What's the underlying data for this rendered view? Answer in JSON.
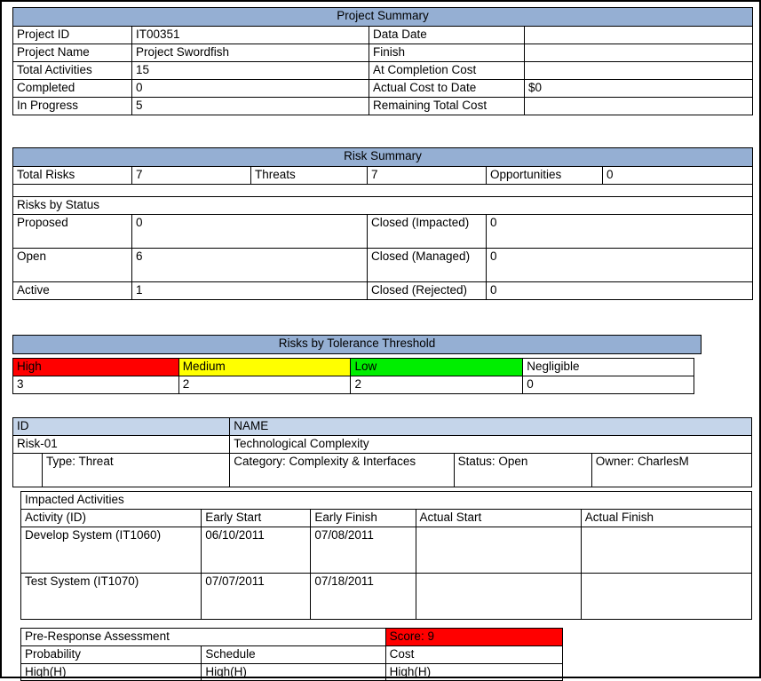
{
  "project_summary": {
    "title": "Project Summary",
    "rows": [
      {
        "label_left": "Project ID",
        "value_left": "IT00351",
        "label_right": "Data Date",
        "value_right": ""
      },
      {
        "label_left": "Project Name",
        "value_left": "Project Swordfish",
        "label_right": "Finish",
        "value_right": ""
      },
      {
        "label_left": "Total Activities",
        "value_left": "15",
        "label_right": "At Completion Cost",
        "value_right": ""
      },
      {
        "label_left": "Completed",
        "value_left": "0",
        "label_right": "Actual Cost to Date",
        "value_right": "$0"
      },
      {
        "label_left": "In Progress",
        "value_left": "5",
        "label_right": "Remaining Total Cost",
        "value_right": ""
      }
    ]
  },
  "risk_summary": {
    "title": "Risk Summary",
    "totals": {
      "total_risks_label": "Total Risks",
      "total_risks_value": "7",
      "threats_label": "Threats",
      "threats_value": "7",
      "opportunities_label": "Opportunities",
      "opportunities_value": "0"
    },
    "spacer": "",
    "status_header": "Risks by Status",
    "status_rows": [
      {
        "label_left": "Proposed",
        "value_left": "0",
        "label_right": "Closed (Impacted)",
        "value_right": "0"
      },
      {
        "label_left": "Open",
        "value_left": "6",
        "label_right": "Closed (Managed)",
        "value_right": "0"
      },
      {
        "label_left": "Active",
        "value_left": "1",
        "label_right": "Closed (Rejected)",
        "value_right": "0"
      }
    ]
  },
  "tolerance": {
    "title": "Risks by Tolerance Threshold",
    "columns": [
      {
        "label": "High",
        "value": "3",
        "color": "#FF0000"
      },
      {
        "label": "Medium",
        "value": "2",
        "color": "#FFFF00"
      },
      {
        "label": "Low",
        "value": "2",
        "color": "#00EE00"
      },
      {
        "label": "Negligible",
        "value": "0",
        "color": "#FFFFFF"
      }
    ]
  },
  "risk_detail": {
    "col_id_header": "ID",
    "col_name_header": "NAME",
    "id": "Risk-01",
    "name": "Technological Complexity",
    "type": "Type: Threat",
    "category": "Category: Complexity & Interfaces",
    "status": "Status: Open",
    "owner": "Owner: CharlesM",
    "impacted_activities": {
      "title": "Impacted Activities",
      "headers": [
        "Activity (ID)",
        "Early Start",
        "Early Finish",
        "Actual Start",
        "Actual Finish"
      ],
      "rows": [
        {
          "activity": "Develop System (IT1060)",
          "early_start": "06/10/2011",
          "early_finish": "07/08/2011",
          "actual_start": "",
          "actual_finish": ""
        },
        {
          "activity": "Test System (IT1070)",
          "early_start": "07/07/2011",
          "early_finish": "07/18/2011",
          "actual_start": "",
          "actual_finish": ""
        }
      ]
    },
    "pre_response": {
      "title": "Pre-Response Assessment",
      "score": "Score: 9",
      "score_color": "#FF0000",
      "headers": [
        "Probability",
        "Schedule",
        "Cost"
      ],
      "values": [
        "High(H)",
        "High(H)",
        "High(H)"
      ]
    }
  }
}
